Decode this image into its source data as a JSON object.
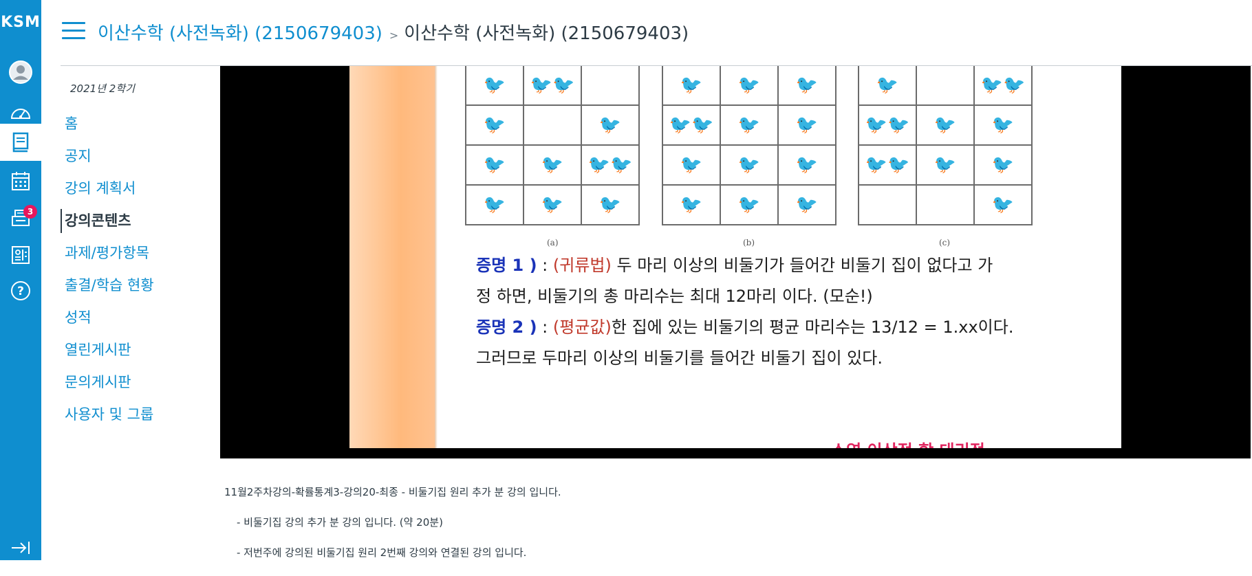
{
  "global_nav": {
    "logo": "KSM",
    "items": [
      {
        "icon": "account-avatar-icon",
        "label": "Account"
      },
      {
        "icon": "dashboard-gauge-icon",
        "label": "Dashboard"
      },
      {
        "icon": "courses-book-icon",
        "label": "Courses",
        "active": true
      },
      {
        "icon": "calendar-icon",
        "label": "Calendar"
      },
      {
        "icon": "inbox-icon",
        "label": "Inbox",
        "badge": "3"
      },
      {
        "icon": "commons-icon",
        "label": "Commons"
      },
      {
        "icon": "help-icon",
        "label": "Help"
      }
    ],
    "collapse_icon": "collapse-arrow-icon"
  },
  "header": {
    "course_link": "이산수학 (사전녹화) (2150679403)",
    "separator": ">",
    "current_page": "이산수학 (사전녹화) (2150679403)"
  },
  "course_nav": {
    "term": "2021년 2학기",
    "items": [
      {
        "label": "홈"
      },
      {
        "label": "공지"
      },
      {
        "label": "강의 계획서"
      },
      {
        "label": "강의콘텐츠",
        "active": true
      },
      {
        "label": "과제/평가항목"
      },
      {
        "label": "출결/학습 현황"
      },
      {
        "label": "성적"
      },
      {
        "label": "열린게시판"
      },
      {
        "label": "문의게시판"
      },
      {
        "label": "사용자 및 그룹"
      }
    ]
  },
  "video": {
    "captions": [
      "(a)",
      "(b)",
      "(c)"
    ],
    "grid_a": [
      [
        "🐦",
        "🐦🐦",
        ""
      ],
      [
        "🐦",
        "",
        "🐦"
      ],
      [
        "🐦",
        "🐦",
        "🐦🐦"
      ],
      [
        "🐦",
        "🐦",
        "🐦"
      ]
    ],
    "grid_b": [
      [
        "🐦",
        "🐦",
        "🐦"
      ],
      [
        "🐦🐦",
        "🐦",
        "🐦"
      ],
      [
        "🐦",
        "🐦",
        "🐦"
      ],
      [
        "🐦",
        "🐦",
        "🐦"
      ]
    ],
    "grid_c": [
      [
        "🐦",
        "",
        "🐦🐦"
      ],
      [
        "🐦🐦",
        "🐦",
        "🐦"
      ],
      [
        "🐦🐦",
        "🐦",
        "🐦"
      ],
      [
        "",
        "",
        "🐦"
      ]
    ],
    "proof1_label": "증명 1 )",
    "proof1_colon": " : ",
    "proof1_method": "(귀류법)",
    "proof1_text": " 두 마리 이상의 비둘기가 들어간 비둘기 집이 없다고 가",
    "proof1_line2": "정 하면, 비둘기의 총 마리수는 최대 12마리 이다. (모순!)",
    "proof2_label": "증명 2 )",
    "proof2_colon": " : ",
    "proof2_method": "(평균값)",
    "proof2_text": "한 집에 있는 비둘기의 평균 마리수는 13/12 = 1.xx이다.",
    "proof2_line2": "그러므로 두마리 이상의 비둘기를 들어간 비둘기 집이 있다.",
    "cut_text": "소역 이상적 합 대리적"
  },
  "description": {
    "line1": "11월2주차강의-확률통계3-강의20-최종 - 비둘기집 원리 추가 분 강의 입니다.",
    "line2": "- 비둘기집 강의 추가 분 강의 입니다. (약 20분)",
    "line3": "- 저번주에 강의된 비둘기집 원리 2번째 강의와 연결된 강의 입니다."
  },
  "colors": {
    "accent": "#0f8ecf",
    "badge": "#e8175d",
    "proof_label": "#1a33b8",
    "proof_method": "#c0392b"
  }
}
